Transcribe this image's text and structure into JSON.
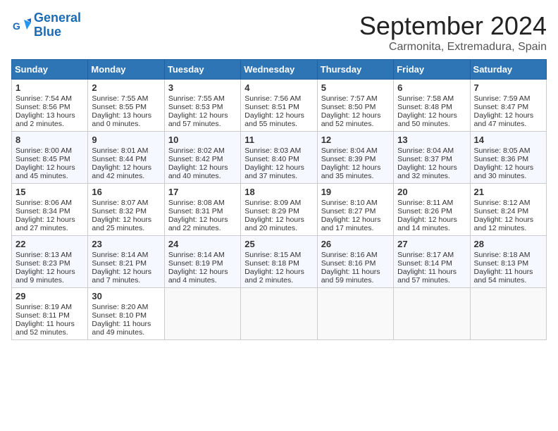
{
  "logo": {
    "line1": "General",
    "line2": "Blue"
  },
  "title": "September 2024",
  "location": "Carmonita, Extremadura, Spain",
  "weekdays": [
    "Sunday",
    "Monday",
    "Tuesday",
    "Wednesday",
    "Thursday",
    "Friday",
    "Saturday"
  ],
  "weeks": [
    [
      {
        "day": "1",
        "sunrise": "Sunrise: 7:54 AM",
        "sunset": "Sunset: 8:56 PM",
        "daylight": "Daylight: 13 hours and 2 minutes."
      },
      {
        "day": "2",
        "sunrise": "Sunrise: 7:55 AM",
        "sunset": "Sunset: 8:55 PM",
        "daylight": "Daylight: 13 hours and 0 minutes."
      },
      {
        "day": "3",
        "sunrise": "Sunrise: 7:55 AM",
        "sunset": "Sunset: 8:53 PM",
        "daylight": "Daylight: 12 hours and 57 minutes."
      },
      {
        "day": "4",
        "sunrise": "Sunrise: 7:56 AM",
        "sunset": "Sunset: 8:51 PM",
        "daylight": "Daylight: 12 hours and 55 minutes."
      },
      {
        "day": "5",
        "sunrise": "Sunrise: 7:57 AM",
        "sunset": "Sunset: 8:50 PM",
        "daylight": "Daylight: 12 hours and 52 minutes."
      },
      {
        "day": "6",
        "sunrise": "Sunrise: 7:58 AM",
        "sunset": "Sunset: 8:48 PM",
        "daylight": "Daylight: 12 hours and 50 minutes."
      },
      {
        "day": "7",
        "sunrise": "Sunrise: 7:59 AM",
        "sunset": "Sunset: 8:47 PM",
        "daylight": "Daylight: 12 hours and 47 minutes."
      }
    ],
    [
      {
        "day": "8",
        "sunrise": "Sunrise: 8:00 AM",
        "sunset": "Sunset: 8:45 PM",
        "daylight": "Daylight: 12 hours and 45 minutes."
      },
      {
        "day": "9",
        "sunrise": "Sunrise: 8:01 AM",
        "sunset": "Sunset: 8:44 PM",
        "daylight": "Daylight: 12 hours and 42 minutes."
      },
      {
        "day": "10",
        "sunrise": "Sunrise: 8:02 AM",
        "sunset": "Sunset: 8:42 PM",
        "daylight": "Daylight: 12 hours and 40 minutes."
      },
      {
        "day": "11",
        "sunrise": "Sunrise: 8:03 AM",
        "sunset": "Sunset: 8:40 PM",
        "daylight": "Daylight: 12 hours and 37 minutes."
      },
      {
        "day": "12",
        "sunrise": "Sunrise: 8:04 AM",
        "sunset": "Sunset: 8:39 PM",
        "daylight": "Daylight: 12 hours and 35 minutes."
      },
      {
        "day": "13",
        "sunrise": "Sunrise: 8:04 AM",
        "sunset": "Sunset: 8:37 PM",
        "daylight": "Daylight: 12 hours and 32 minutes."
      },
      {
        "day": "14",
        "sunrise": "Sunrise: 8:05 AM",
        "sunset": "Sunset: 8:36 PM",
        "daylight": "Daylight: 12 hours and 30 minutes."
      }
    ],
    [
      {
        "day": "15",
        "sunrise": "Sunrise: 8:06 AM",
        "sunset": "Sunset: 8:34 PM",
        "daylight": "Daylight: 12 hours and 27 minutes."
      },
      {
        "day": "16",
        "sunrise": "Sunrise: 8:07 AM",
        "sunset": "Sunset: 8:32 PM",
        "daylight": "Daylight: 12 hours and 25 minutes."
      },
      {
        "day": "17",
        "sunrise": "Sunrise: 8:08 AM",
        "sunset": "Sunset: 8:31 PM",
        "daylight": "Daylight: 12 hours and 22 minutes."
      },
      {
        "day": "18",
        "sunrise": "Sunrise: 8:09 AM",
        "sunset": "Sunset: 8:29 PM",
        "daylight": "Daylight: 12 hours and 20 minutes."
      },
      {
        "day": "19",
        "sunrise": "Sunrise: 8:10 AM",
        "sunset": "Sunset: 8:27 PM",
        "daylight": "Daylight: 12 hours and 17 minutes."
      },
      {
        "day": "20",
        "sunrise": "Sunrise: 8:11 AM",
        "sunset": "Sunset: 8:26 PM",
        "daylight": "Daylight: 12 hours and 14 minutes."
      },
      {
        "day": "21",
        "sunrise": "Sunrise: 8:12 AM",
        "sunset": "Sunset: 8:24 PM",
        "daylight": "Daylight: 12 hours and 12 minutes."
      }
    ],
    [
      {
        "day": "22",
        "sunrise": "Sunrise: 8:13 AM",
        "sunset": "Sunset: 8:23 PM",
        "daylight": "Daylight: 12 hours and 9 minutes."
      },
      {
        "day": "23",
        "sunrise": "Sunrise: 8:14 AM",
        "sunset": "Sunset: 8:21 PM",
        "daylight": "Daylight: 12 hours and 7 minutes."
      },
      {
        "day": "24",
        "sunrise": "Sunrise: 8:14 AM",
        "sunset": "Sunset: 8:19 PM",
        "daylight": "Daylight: 12 hours and 4 minutes."
      },
      {
        "day": "25",
        "sunrise": "Sunrise: 8:15 AM",
        "sunset": "Sunset: 8:18 PM",
        "daylight": "Daylight: 12 hours and 2 minutes."
      },
      {
        "day": "26",
        "sunrise": "Sunrise: 8:16 AM",
        "sunset": "Sunset: 8:16 PM",
        "daylight": "Daylight: 11 hours and 59 minutes."
      },
      {
        "day": "27",
        "sunrise": "Sunrise: 8:17 AM",
        "sunset": "Sunset: 8:14 PM",
        "daylight": "Daylight: 11 hours and 57 minutes."
      },
      {
        "day": "28",
        "sunrise": "Sunrise: 8:18 AM",
        "sunset": "Sunset: 8:13 PM",
        "daylight": "Daylight: 11 hours and 54 minutes."
      }
    ],
    [
      {
        "day": "29",
        "sunrise": "Sunrise: 8:19 AM",
        "sunset": "Sunset: 8:11 PM",
        "daylight": "Daylight: 11 hours and 52 minutes."
      },
      {
        "day": "30",
        "sunrise": "Sunrise: 8:20 AM",
        "sunset": "Sunset: 8:10 PM",
        "daylight": "Daylight: 11 hours and 49 minutes."
      },
      null,
      null,
      null,
      null,
      null
    ]
  ]
}
